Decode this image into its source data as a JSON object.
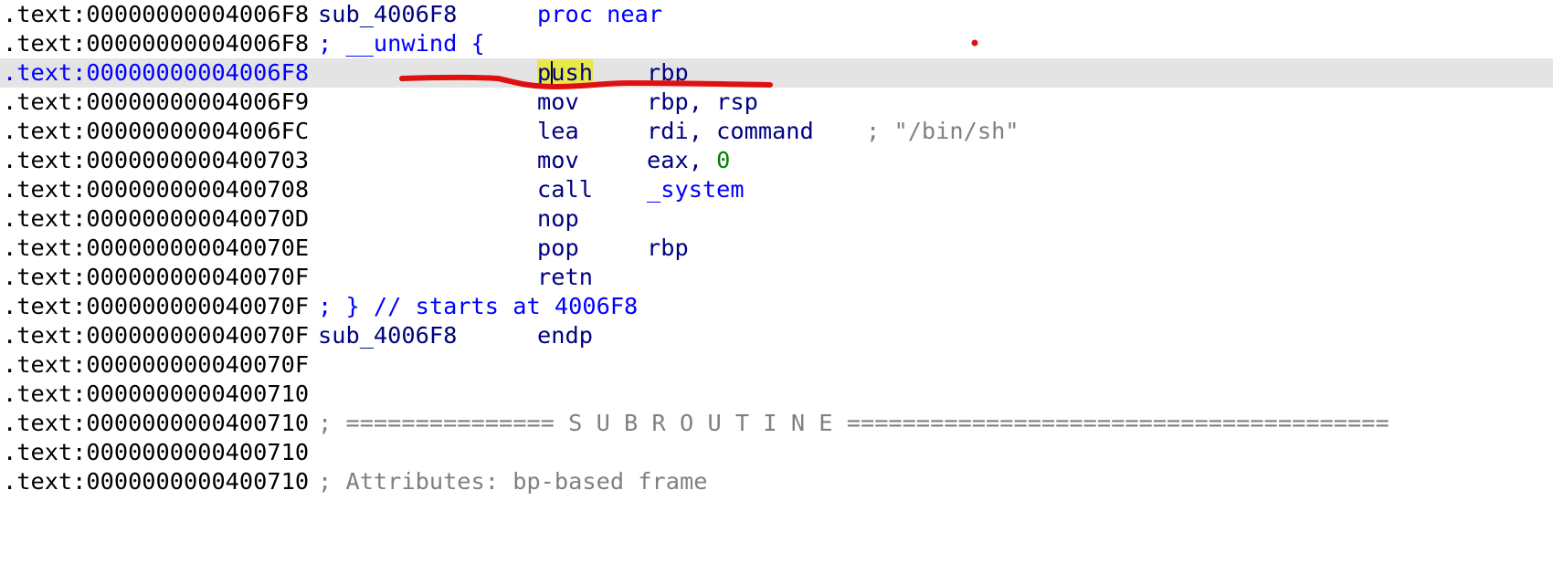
{
  "listing": {
    "lines": [
      {
        "addr": ".text:00000000004006F8",
        "label": "sub_4006F8",
        "mnemonic": "proc near"
      },
      {
        "addr": ".text:00000000004006F8",
        "comment": "; __unwind {"
      },
      {
        "addr": ".text:00000000004006F8",
        "mnemonic": "push",
        "operands": "rbp",
        "current": true
      },
      {
        "addr": ".text:00000000004006F9",
        "mnemonic": "mov",
        "operands": "rbp, rsp"
      },
      {
        "addr": ".text:00000000004006FC",
        "mnemonic": "lea",
        "operands": "rdi, command",
        "comment": "; \"/bin/sh\""
      },
      {
        "addr": ".text:0000000000400703",
        "mnemonic": "mov",
        "operands_prefix": "eax, ",
        "operands_number": "0"
      },
      {
        "addr": ".text:0000000000400708",
        "mnemonic": "call",
        "operands_symbol": "_system"
      },
      {
        "addr": ".text:000000000040070D",
        "mnemonic": "nop"
      },
      {
        "addr": ".text:000000000040070E",
        "mnemonic": "pop",
        "operands": "rbp"
      },
      {
        "addr": ".text:000000000040070F",
        "mnemonic": "retn"
      },
      {
        "addr": ".text:000000000040070F",
        "comment": "; } // starts at 4006F8"
      },
      {
        "addr": ".text:000000000040070F",
        "label": "sub_4006F8",
        "mnemonic": "endp"
      },
      {
        "addr": ".text:000000000040070F"
      },
      {
        "addr": ".text:0000000000400710"
      },
      {
        "addr": ".text:0000000000400710",
        "comment": "; =============== S U B R O U T I N E ======================================="
      },
      {
        "addr": ".text:0000000000400710"
      },
      {
        "addr": ".text:0000000000400710",
        "comment": "; Attributes: bp-based frame"
      }
    ],
    "current_line_row_marker": "▾",
    "highlight_word_first": "p",
    "highlight_word_rest": "ush"
  },
  "colors": {
    "address": "#000000",
    "address_current": "#0000ff",
    "mnemonic": "#000080",
    "keyword_blue": "#0000ff",
    "number": "#008000",
    "comment": "#808080",
    "current_line_bg": "#e4e4e4",
    "word_highlight": "#e8e84a",
    "annotation_red": "#e01010"
  }
}
